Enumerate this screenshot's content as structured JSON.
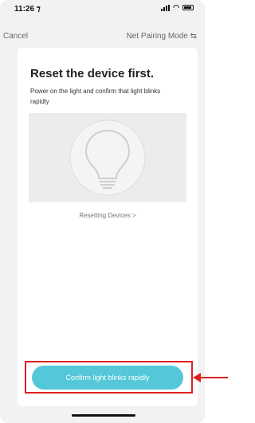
{
  "status_bar": {
    "time": "11:26 ⁊",
    "icons": [
      "signal-icon",
      "wifi-icon",
      "battery-icon"
    ]
  },
  "nav": {
    "cancel_label": "Cancel",
    "mode_label": "Net Pairing Mode ⇆"
  },
  "card": {
    "title": "Reset the device first.",
    "description": "Power on the light and confirm that light blinks rapidly",
    "illustration_icon": "light-bulb-icon",
    "reset_link": "Resetting Devices >",
    "confirm_button": "Confirm light blinks rapidly"
  },
  "colors": {
    "accent": "#54c8d8",
    "highlight": "#e02020",
    "background": "#f2f2f2"
  }
}
